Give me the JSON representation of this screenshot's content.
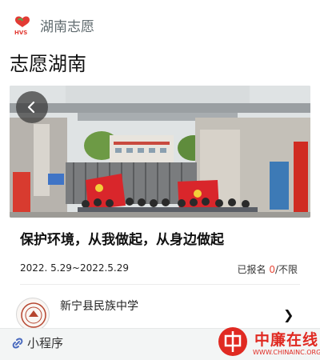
{
  "header": {
    "logo_text": "HVS",
    "app_name": "湖南志愿"
  },
  "page": {
    "title": "志愿湖南"
  },
  "hero": {
    "description": "school gate group photo banner",
    "back_icon": "chevron-left-icon"
  },
  "event": {
    "title": "保护环境，从我做起，从身边做起",
    "date_range": "2022. 5.29~2022.5.29",
    "signup_label": "已报名 ",
    "signup_count": "0",
    "signup_limit": "/不限"
  },
  "organizer": {
    "name": "新宁县民族中学"
  },
  "bottom_bar": {
    "mini_program_label": "小程序",
    "icon": "link-icon"
  },
  "watermark": {
    "brand": "中廉在线",
    "url": "WWW.CHINAINC.ORG.CN"
  },
  "colors": {
    "accent_red": "#e84a3a",
    "watermark_red": "#e02a22",
    "muted_text": "#5f6a6e"
  }
}
